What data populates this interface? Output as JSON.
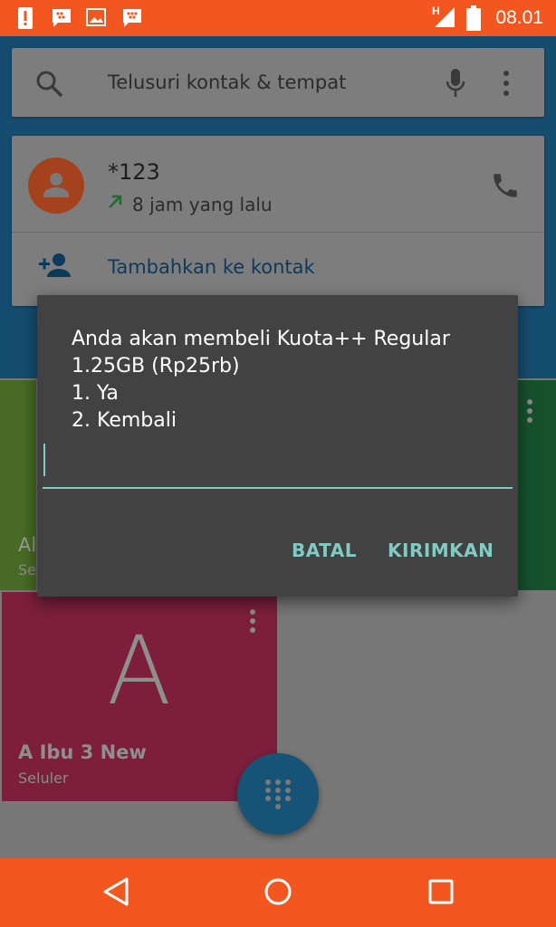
{
  "status_bar": {
    "time": "08.01",
    "network_label": "H",
    "icons": [
      "alert-icon",
      "bbm-chat-icon",
      "image-icon",
      "bbm-icon",
      "signal-icon",
      "battery-icon"
    ]
  },
  "search": {
    "placeholder": "Telusuri kontak & tempat",
    "icons": [
      "search-icon",
      "mic-icon",
      "more-vert-icon"
    ]
  },
  "recent_call": {
    "number": "*123",
    "time_ago": "8 jam yang lalu",
    "add_contact_label": "Tambahkan ke kontak"
  },
  "favorites": [
    {
      "name": "Al",
      "type": "Se"
    },
    {
      "letter": "A",
      "name": "A Ibu 3 New",
      "type": "Seluler"
    }
  ],
  "ussd_dialog": {
    "message_lines": [
      "Anda akan membeli Kuota++ Regular",
      "1.25GB (Rp25rb)",
      "1. Ya",
      "2. Kembali"
    ],
    "input_value": "",
    "cancel_label": "BATAL",
    "send_label": "KIRIMKAN"
  },
  "colors": {
    "status_bar": "#f3561e",
    "accent": "#80cbc4",
    "dialog_bg": "#424242",
    "app_bar": "#154d70"
  },
  "nav_bar": {
    "icons": [
      "back-icon",
      "home-icon",
      "recents-icon"
    ]
  }
}
